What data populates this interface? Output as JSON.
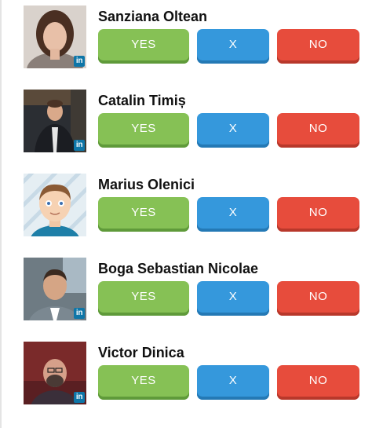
{
  "people": [
    {
      "name": "Sanziana Oltean",
      "badge": "in",
      "yes_label": "YES",
      "x_label": "X",
      "no_label": "NO"
    },
    {
      "name": "Catalin Timiș",
      "badge": "in",
      "yes_label": "YES",
      "x_label": "X",
      "no_label": "NO"
    },
    {
      "name": "Marius Olenici",
      "badge": "",
      "yes_label": "YES",
      "x_label": "X",
      "no_label": "NO"
    },
    {
      "name": "Boga Sebastian Nicolae",
      "badge": "in",
      "yes_label": "YES",
      "x_label": "X",
      "no_label": "NO"
    },
    {
      "name": "Victor Dinica",
      "badge": "in",
      "yes_label": "YES",
      "x_label": "X",
      "no_label": "NO"
    }
  ],
  "colors": {
    "yes": "#86c155",
    "x": "#3598dc",
    "no": "#e74c3c",
    "linkedin": "#0e76a8"
  },
  "icons": {
    "badge_icon": "linkedin-icon"
  }
}
